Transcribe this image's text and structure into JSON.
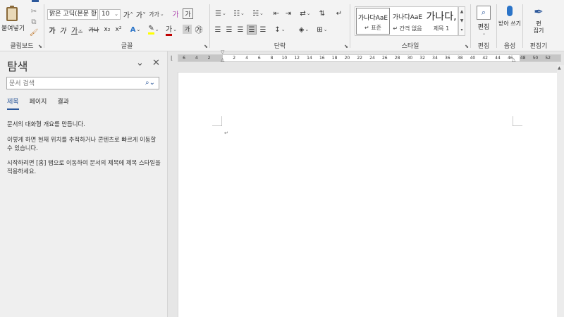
{
  "ribbon": {
    "clipboard": {
      "group": "클립보드",
      "paste": "붙여넣기"
    },
    "font": {
      "group": "글꼴",
      "font_name": "맑은 고딕(본문 한",
      "font_size": "10",
      "grow": "가˄",
      "shrink": "가˅",
      "case": "가가",
      "clear": "가",
      "bold": "가",
      "italic": "가",
      "underline": "가",
      "strike": "가나",
      "sub": "x₂",
      "sup": "x²",
      "highlight": "ab",
      "color": "가",
      "shade": "가",
      "enclose": "㉮",
      "accent_color": "#c00000",
      "highlight_color": "#ffff00"
    },
    "paragraph": {
      "group": "단락"
    },
    "styles": {
      "group": "스타일",
      "items": [
        {
          "preview": "가나다AaE",
          "name": "표준"
        },
        {
          "preview": "가나다AaE",
          "name": "간격 없음"
        },
        {
          "preview": "가나다,",
          "name": "제목 1"
        }
      ]
    },
    "editing": {
      "group": "편집",
      "label": "편집"
    },
    "voice": {
      "group": "음성",
      "dictate": "받아 쓰기"
    },
    "editor": {
      "group": "편집기",
      "label": "편 집기"
    }
  },
  "nav": {
    "title": "탐색",
    "search_placeholder": "문서 검색",
    "tabs": [
      "제목",
      "페이지",
      "결과"
    ],
    "info1": "문서의 대화형 개요를 만듭니다.",
    "info2": "이렇게 하면 현재 위치를 추적하거나 콘텐츠로 빠르게 이동할 수 있습니다.",
    "info3": "시작하려면 [홈] 탭으로 이동하여 문서의 제목에 제목 스타일을 적용하세요."
  },
  "ruler": {
    "numbers": [
      "6",
      "4",
      "2",
      "2",
      "4",
      "6",
      "8",
      "10",
      "12",
      "14",
      "16",
      "18",
      "20",
      "22",
      "24",
      "26",
      "28",
      "30",
      "32",
      "34",
      "36",
      "38",
      "40",
      "42",
      "44",
      "46",
      "48",
      "50",
      "52"
    ]
  },
  "colors": {
    "accent": "#2b579a"
  }
}
